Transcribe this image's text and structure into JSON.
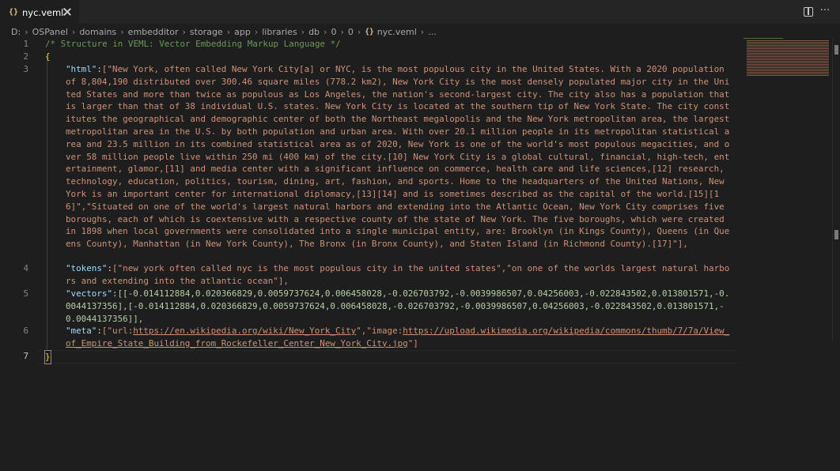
{
  "tab": {
    "icon": "{}",
    "name": "nyc.veml"
  },
  "breadcrumb": [
    "D:",
    "OSPanel",
    "domains",
    "embedditor",
    "storage",
    "app",
    "libraries",
    "db",
    "0",
    "0"
  ],
  "breadcrumb_file": "nyc.veml",
  "breadcrumb_tail": "...",
  "line_numbers": [
    "1",
    "2",
    "3",
    "4",
    "5",
    "6",
    "7"
  ],
  "code": {
    "comment": "/* Structure in VEML: Vector Embedding Markup Language */",
    "open_brace": "{",
    "close_brace": "}",
    "html_key": "\"html\"",
    "html_value": "[\"New York, often called New York City[a] or NYC, is the most populous city in the United States. With a 2020 population of 8,804,190 distributed over 300.46 square miles (778.2 km2), New York City is the most densely populated major city in the United States and more than twice as populous as Los Angeles, the nation's second-largest city. The city also has a population that is larger than that of 38 individual U.S. states. New York City is located at the southern tip of New York State. The city constitutes the geographical and demographic center of both the Northeast megalopolis and the New York metropolitan area, the largest metropolitan area in the U.S. by both population and urban area. With over 20.1 million people in its metropolitan statistical area and 23.5 million in its combined statistical area as of 2020, New York is one of the world's most populous megacities, and over 58 million people live within 250 mi (400 km) of the city.[10] New York City is a global cultural, financial, high-tech, entertainment, glamor,[11] and media center with a significant influence on commerce, health care and life sciences,[12] research, technology, education, politics, tourism, dining, art, fashion, and sports. Home to the headquarters of the United Nations, New York is an important center for international diplomacy,[13][14] and is sometimes described as the capital of the world.[15][16]\",\"Situated on one of the world's largest natural harbors and extending into the Atlantic Ocean, New York City comprises five boroughs, each of which is coextensive with a respective county of the state of New York. The five boroughs, which were created in 1898 when local governments were consolidated into a single municipal entity, are: Brooklyn (in Kings County), Queens (in Queens County), Manhattan (in New York County), The Bronx (in Bronx County), and Staten Island (in Richmond County).[17]\"],",
    "tokens_key": "\"tokens\"",
    "tokens_value": "[\"new york often called nyc is the most populous city in the united states\",\"on one of the worlds largest natural harbors and extending into the atlantic ocean\"],",
    "vectors_key": "\"vectors\"",
    "vectors_value": "[[-0.014112884,0.020366829,0.0059737624,0.006458028,-0.026703792,-0.0039986507,0.04256003,-0.022843502,0.013801571,-0.0044137356],[-0.014112884,0.020366829,0.0059737624,0.006458028,-0.026703792,-0.0039986507,0.04256003,-0.022843502,0.013801571,-0.0044137356]],",
    "meta_key": "\"meta\"",
    "meta_value_prefix": "[\"url:",
    "meta_url": "https://en.wikipedia.org/wiki/New_York_City",
    "meta_mid": "\",\"image:",
    "meta_image": "https://upload.wikimedia.org/wikipedia/commons/thumb/7/7a/View_of_Empire_State_Building_from_Rockefeller_Center_New_York_City.jpg",
    "meta_suffix": "\"]"
  },
  "colors": {
    "background": "#1e1e1e",
    "string": "#ce9178",
    "key": "#9cdcfe",
    "comment": "#6a9955",
    "brace": "#ffd700"
  }
}
